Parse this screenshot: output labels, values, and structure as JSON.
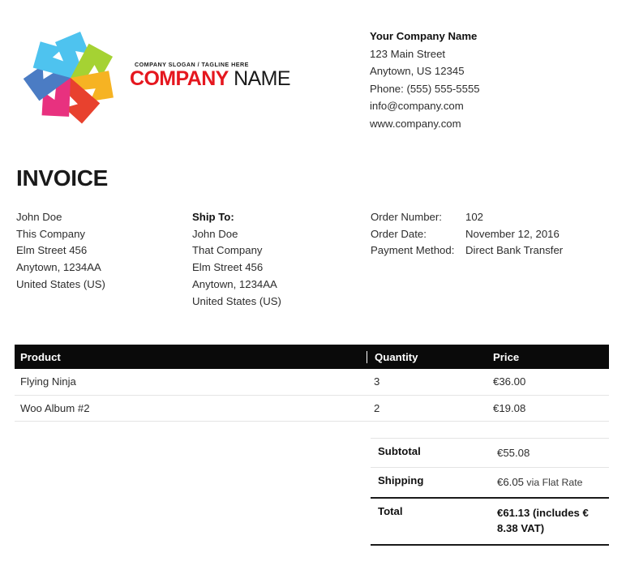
{
  "logo": {
    "slogan": "COMPANY SLOGAN / TAGLINE HERE",
    "name_part1": "COMPANY",
    "name_part2": " NAME",
    "mark_icon": "pinwheel-logo-icon",
    "petal_colors": [
      "#e8317f",
      "#4b7cc4",
      "#4ec3ef",
      "#a5d233",
      "#f6b323",
      "#e8412e",
      "#e8317f"
    ]
  },
  "company": {
    "name": "Your Company Name",
    "address_line1": "123 Main Street",
    "address_line2": "Anytown, US 12345",
    "phone": "Phone: (555) 555-5555",
    "email": "info@company.com",
    "website": "www.company.com"
  },
  "page_title": "INVOICE",
  "billing": {
    "lines": [
      "John Doe",
      "This Company",
      "Elm Street 456",
      "Anytown, 1234AA",
      "United States (US)"
    ]
  },
  "shipping": {
    "label": "Ship To:",
    "lines": [
      "John Doe",
      "That Company",
      "Elm Street 456",
      "Anytown, 1234AA",
      "United States (US)"
    ]
  },
  "order_meta": [
    {
      "key": "Order Number:",
      "value": "102"
    },
    {
      "key": "Order Date:",
      "value": "November 12, 2016"
    },
    {
      "key": "Payment Method:",
      "value": "Direct Bank Transfer"
    }
  ],
  "items_table": {
    "headers": {
      "product": "Product",
      "quantity": "Quantity",
      "price": "Price"
    },
    "rows": [
      {
        "product": "Flying Ninja",
        "quantity": "3",
        "price": "€36.00"
      },
      {
        "product": "Woo Album #2",
        "quantity": "2",
        "price": "€19.08"
      }
    ]
  },
  "totals": {
    "subtotal_label": "Subtotal",
    "subtotal_value": "€55.08",
    "shipping_label": "Shipping",
    "shipping_value": "€6.05",
    "shipping_note": " via Flat Rate",
    "total_label": "Total",
    "total_value": "€61.13 (includes € 8.38 VAT)"
  },
  "colors": {
    "table_header_bg": "#0a0a0a",
    "table_header_text": "#ffffff",
    "accent_red": "#e5171f",
    "rule_light": "#e4e4e4",
    "rule_dark": "#1a1a1a",
    "text": "#2d2d2d"
  }
}
